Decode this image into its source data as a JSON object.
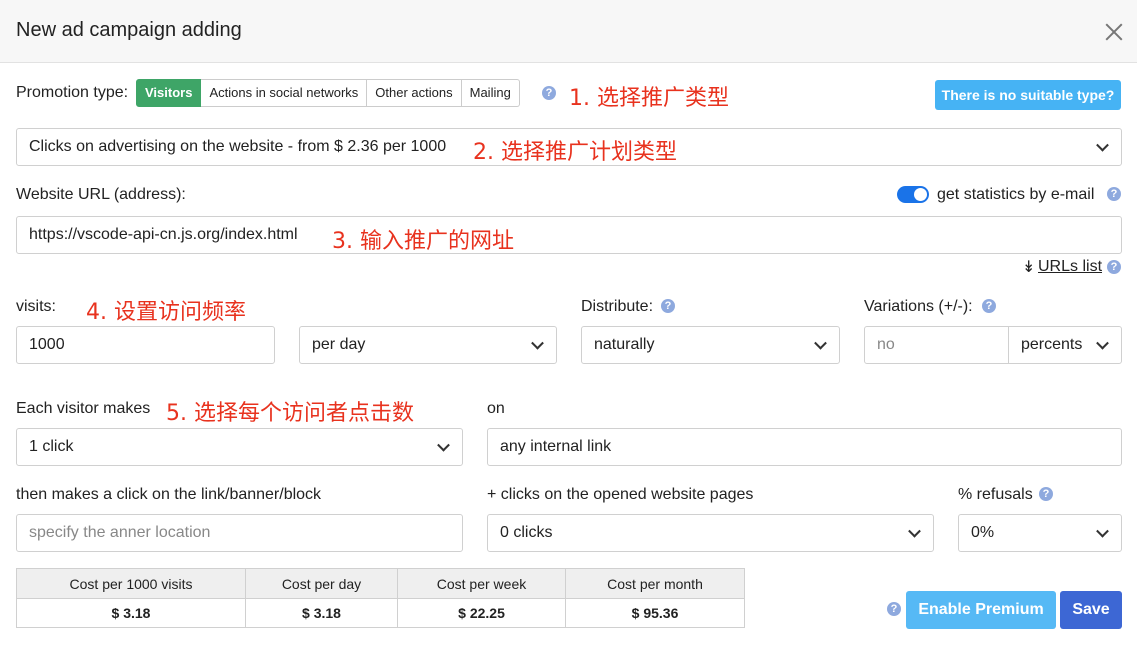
{
  "dialog": {
    "title": "New ad campaign adding",
    "close_icon": "close-icon"
  },
  "promotion": {
    "label": "Promotion type:",
    "options": [
      "Visitors",
      "Actions in social networks",
      "Other actions",
      "Mailing"
    ],
    "selected": "Visitors",
    "no_suitable_label": "There is no suitable type?"
  },
  "annotations": {
    "a1": "1. 选择推广类型",
    "a2": "2. 选择推广计划类型",
    "a3": "3. 输入推广的网址",
    "a4": "4. 设置访问频率",
    "a5": "5. 选择每个访问者点击数"
  },
  "plan_type": {
    "value": "Clicks on advertising on the website - from $ 2.36 per 1000"
  },
  "website": {
    "label": "Website URL (address):",
    "value": "https://vscode-api-cn.js.org/index.html",
    "stats_label": "get statistics by e-mail",
    "stats_enabled": true,
    "urls_list_label": "URLs list"
  },
  "visits": {
    "label": "visits:",
    "value": "1000",
    "period": "per day",
    "distribute_label": "Distribute:",
    "distribute_value": "naturally",
    "variations_label": "Variations (+/-):",
    "variations_placeholder": "no",
    "variations_unit": "percents"
  },
  "clicks": {
    "each_label": "Each visitor makes",
    "each_value": "1 click",
    "on_label": "on",
    "on_value": "any internal link",
    "then_label": "then makes a click on the link/banner/block",
    "then_placeholder": "specify the anner location",
    "plus_label": "+ clicks on the opened website pages",
    "plus_value": "0 clicks",
    "refusals_label": "% refusals",
    "refusals_value": "0%"
  },
  "costs": {
    "headers": [
      "Cost per 1000 visits",
      "Cost per day",
      "Cost per week",
      "Cost per month"
    ],
    "values": [
      "$ 3.18",
      "$ 3.18",
      "$ 22.25",
      "$ 95.36"
    ]
  },
  "footer": {
    "premium_label": "Enable Premium",
    "save_label": "Save"
  }
}
